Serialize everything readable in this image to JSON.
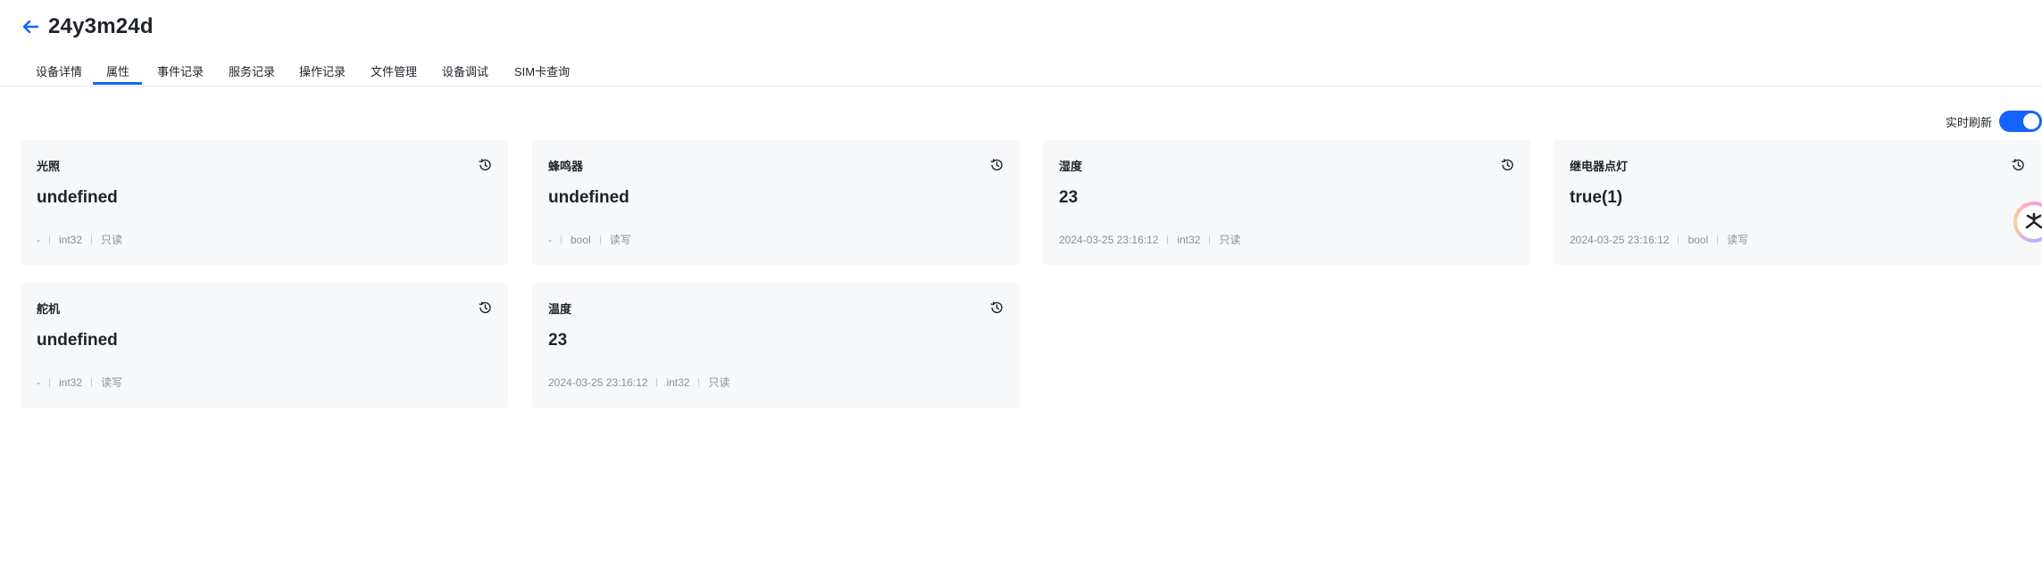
{
  "header": {
    "title": "24y3m24d"
  },
  "tabs": [
    {
      "label": "设备详情"
    },
    {
      "label": "属性"
    },
    {
      "label": "事件记录"
    },
    {
      "label": "服务记录"
    },
    {
      "label": "操作记录"
    },
    {
      "label": "文件管理"
    },
    {
      "label": "设备调试"
    },
    {
      "label": "SIM卡查询"
    }
  ],
  "active_tab": "属性",
  "refresh": {
    "label": "实时刷新",
    "enabled": true
  },
  "properties": [
    {
      "name": "光照",
      "value": "undefined",
      "time": "-",
      "type": "int32",
      "access": "只读"
    },
    {
      "name": "蜂鸣器",
      "value": "undefined",
      "time": "-",
      "type": "bool",
      "access": "读写"
    },
    {
      "name": "湿度",
      "value": "23",
      "time": "2024-03-25 23:16:12",
      "type": "int32",
      "access": "只读"
    },
    {
      "name": "继电器点灯",
      "value": "true(1)",
      "time": "2024-03-25 23:16:12",
      "type": "bool",
      "access": "读写"
    },
    {
      "name": "舵机",
      "value": "undefined",
      "time": "-",
      "type": "int32",
      "access": "读写"
    },
    {
      "name": "温度",
      "value": "23",
      "time": "2024-03-25 23:16:12",
      "type": "int32",
      "access": "只读"
    }
  ],
  "colors": {
    "accent": "#1664ff",
    "card_bg": "#f7f8fa",
    "meta_text": "#86909c"
  },
  "icons": {
    "back": "arrow-left-icon",
    "history": "history-icon",
    "assistant": "assistant-logo-icon"
  }
}
